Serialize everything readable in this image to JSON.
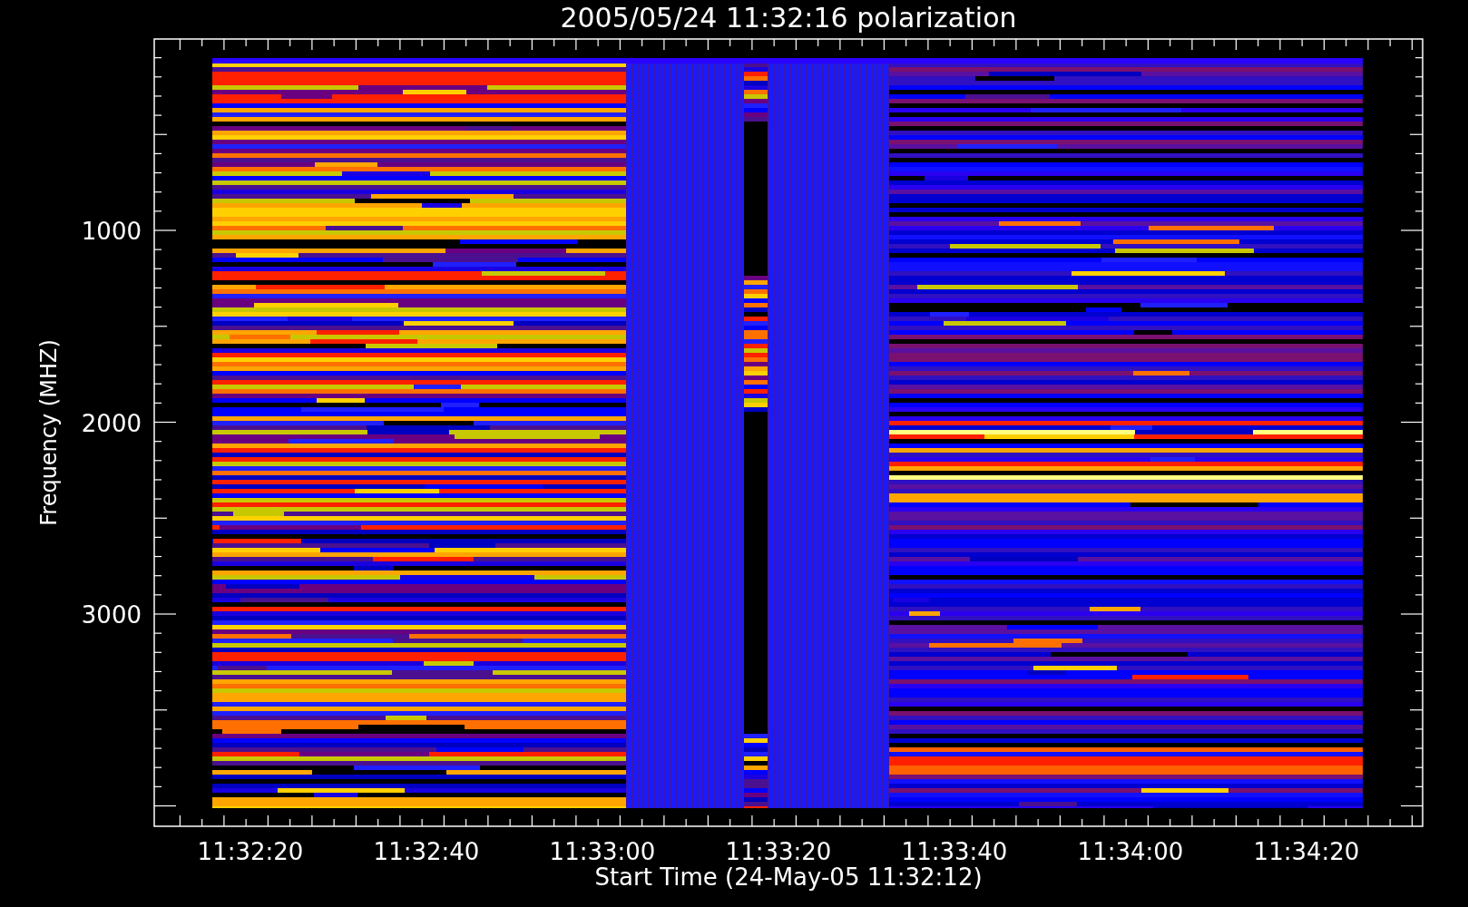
{
  "title": "2005/05/24 11:32:16 polarization",
  "y_axis": {
    "label": "Frequency (MHZ)",
    "ticks": [
      "1000",
      "2000",
      "3000"
    ]
  },
  "x_axis": {
    "label": "Start Time (24-May-05 11:32:12)",
    "ticks": [
      "11:32:20",
      "11:32:40",
      "11:33:00",
      "11:33:20",
      "11:33:40",
      "11:34:00",
      "11:34:20"
    ]
  }
}
